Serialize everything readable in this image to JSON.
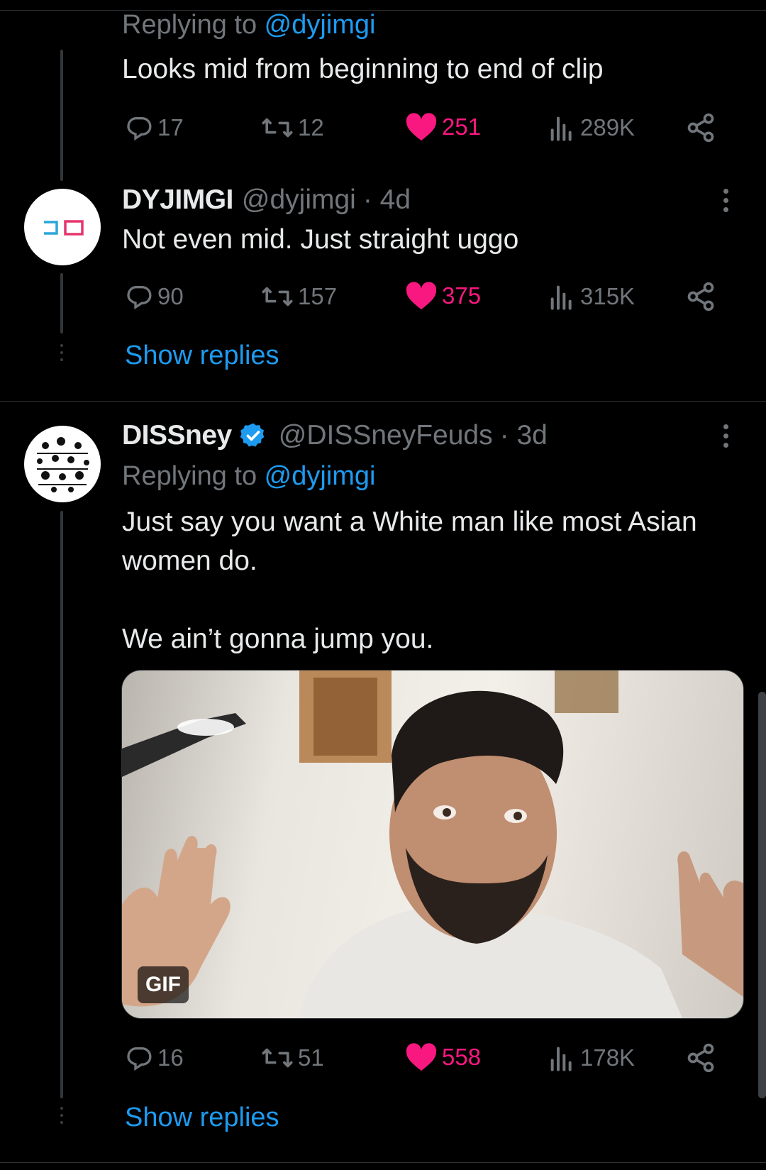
{
  "tweets": [
    {
      "reply_prefix": "Replying to ",
      "reply_handle": "@dyjimgi",
      "text": "Looks mid from beginning to end of clip",
      "stats": {
        "replies": "17",
        "retweets": "12",
        "likes": "251",
        "views": "289K"
      }
    },
    {
      "name": "DYJIMGI",
      "handle": "@dyjimgi",
      "time": "· 4d",
      "text": "Not even mid. Just straight uggo",
      "stats": {
        "replies": "90",
        "retweets": "157",
        "likes": "375",
        "views": "315K"
      },
      "show_replies": "Show replies"
    },
    {
      "name": "DISSney",
      "handle": "@DISSneyFeuds",
      "time": "· 3d",
      "reply_prefix": "Replying to ",
      "reply_handle": "@dyjimgi",
      "text_line1": "Just say you want a White man like most Asian",
      "text_line2": "women do.",
      "text_line3": "We ain’t gonna jump you.",
      "media_badge": "GIF",
      "stats": {
        "replies": "16",
        "retweets": "51",
        "likes": "558",
        "views": "178K"
      },
      "show_replies": "Show replies"
    }
  ],
  "colors": {
    "link": "#1d9bf0",
    "like": "#f91880",
    "muted": "#71767b",
    "verified": "#1d9bf0"
  }
}
